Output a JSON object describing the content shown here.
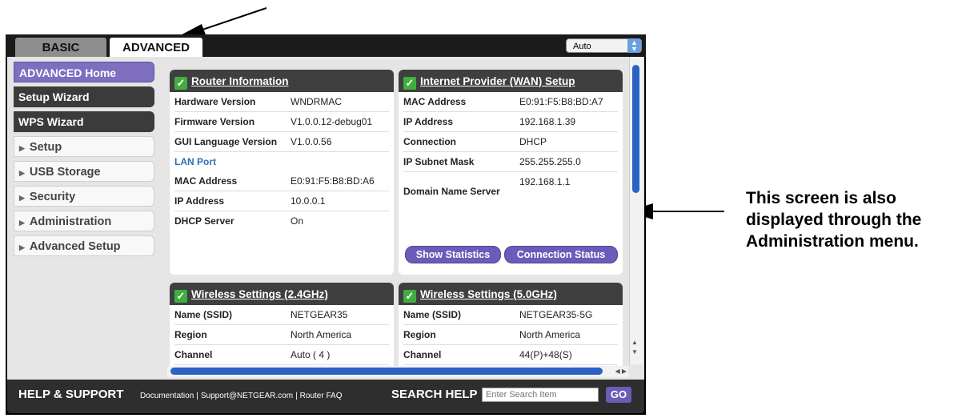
{
  "tabs": {
    "basic": "BASIC",
    "advanced": "ADVANCED"
  },
  "mode_select": {
    "value": "Auto"
  },
  "sidebar": {
    "items": [
      {
        "label": "ADVANCED Home"
      },
      {
        "label": "Setup Wizard"
      },
      {
        "label": "WPS Wizard"
      },
      {
        "label": "Setup"
      },
      {
        "label": "USB Storage"
      },
      {
        "label": "Security"
      },
      {
        "label": "Administration"
      },
      {
        "label": "Advanced Setup"
      }
    ]
  },
  "router_info": {
    "title": "Router Information",
    "rows": [
      {
        "k": "Hardware Version",
        "v": "WNDRMAC"
      },
      {
        "k": "Firmware Version",
        "v": "V1.0.0.12-debug01"
      },
      {
        "k": "GUI Language Version",
        "v": "V1.0.0.56"
      }
    ],
    "lan_label": "LAN Port",
    "lan_rows": [
      {
        "k": "MAC Address",
        "v": "E0:91:F5:B8:BD:A6"
      },
      {
        "k": "IP Address",
        "v": "10.0.0.1"
      },
      {
        "k": "DHCP Server",
        "v": "On"
      }
    ]
  },
  "wan": {
    "title": "Internet Provider (WAN) Setup",
    "rows": [
      {
        "k": "MAC Address",
        "v": "E0:91:F5:B8:BD:A7"
      },
      {
        "k": "IP Address",
        "v": "192.168.1.39"
      },
      {
        "k": "Connection",
        "v": "DHCP"
      },
      {
        "k": "IP Subnet Mask",
        "v": "255.255.255.0"
      },
      {
        "k": "Domain Name Server",
        "v": "192.168.1.1"
      }
    ],
    "btn_stats": "Show Statistics",
    "btn_status": "Connection Status"
  },
  "wifi24": {
    "title": "Wireless Settings (2.4GHz)",
    "rows": [
      {
        "k": "Name (SSID)",
        "v": "NETGEAR35"
      },
      {
        "k": "Region",
        "v": "North America"
      },
      {
        "k": "Channel",
        "v": "Auto ( 4 )"
      }
    ]
  },
  "wifi50": {
    "title": "Wireless Settings (5.0GHz)",
    "rows": [
      {
        "k": "Name (SSID)",
        "v": "NETGEAR35-5G"
      },
      {
        "k": "Region",
        "v": "North America"
      },
      {
        "k": "Channel",
        "v": "44(P)+48(S)"
      }
    ]
  },
  "footer": {
    "help_title": "HELP & SUPPORT",
    "links": [
      "Documentation",
      "Support@NETGEAR.com",
      "Router FAQ"
    ],
    "search_title": "SEARCH HELP",
    "search_placeholder": "Enter Search Item",
    "go": "GO"
  },
  "note": "This screen is also displayed through the Administration menu.",
  "icons": [
    "check-icon",
    "triangle-right-icon",
    "arrow-up-icon",
    "arrow-down-icon",
    "arrow-left-icon",
    "arrow-right-icon"
  ]
}
